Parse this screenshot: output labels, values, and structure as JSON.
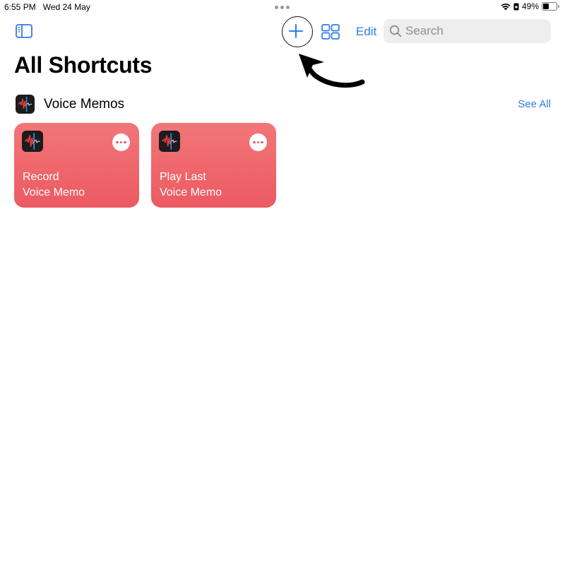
{
  "status_bar": {
    "time": "6:55 PM",
    "date": "Wed 24 May",
    "battery_percent_label": "49%",
    "battery_level": 0.49,
    "icons": [
      "wifi-icon",
      "lock-rotation-icon",
      "battery-icon"
    ]
  },
  "toolbar": {
    "sidebar_toggle_icon": "sidebar-icon",
    "add_icon": "plus-icon",
    "grid_icon": "grid-view-icon",
    "edit_label": "Edit",
    "search_placeholder": "Search",
    "accent_color": "#2b7de9"
  },
  "annotation": {
    "type": "arrow pointing to add button with circle highlight"
  },
  "page": {
    "title": "All Shortcuts"
  },
  "section": {
    "title": "Voice Memos",
    "see_all_label": "See All",
    "app_icon": "voice-memos-icon"
  },
  "shortcuts": [
    {
      "title": "Record\nVoice Memo",
      "color": "#ef6870",
      "icon": "voice-memos-icon"
    },
    {
      "title": "Play Last\nVoice Memo",
      "color": "#ef6870",
      "icon": "voice-memos-icon"
    }
  ]
}
